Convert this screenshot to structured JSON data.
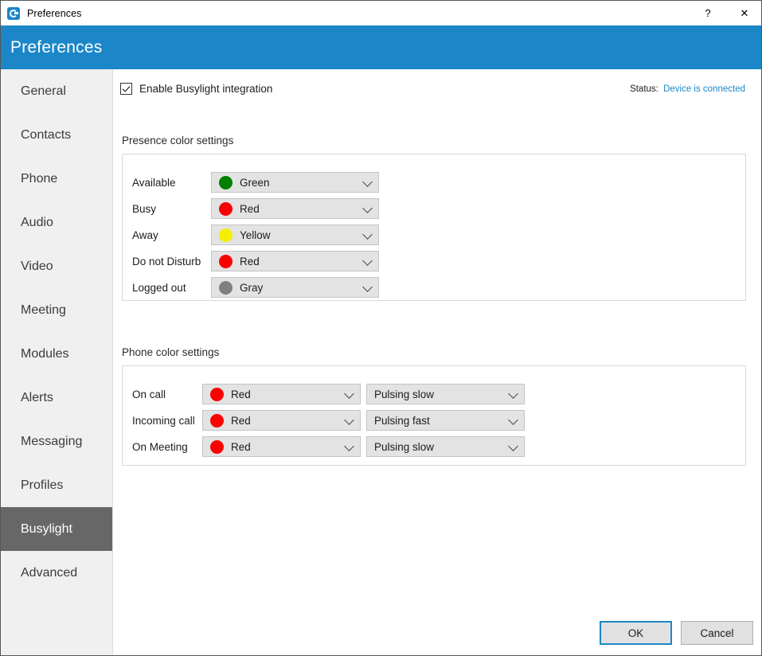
{
  "window": {
    "title": "Preferences",
    "app_icon": "app-logo-icon",
    "help_button": "?",
    "close_button": "✕"
  },
  "header": {
    "title": "Preferences"
  },
  "sidebar": {
    "items": [
      {
        "label": "General",
        "selected": false
      },
      {
        "label": "Contacts",
        "selected": false
      },
      {
        "label": "Phone",
        "selected": false
      },
      {
        "label": "Audio",
        "selected": false
      },
      {
        "label": "Video",
        "selected": false
      },
      {
        "label": "Meeting",
        "selected": false
      },
      {
        "label": "Modules",
        "selected": false
      },
      {
        "label": "Alerts",
        "selected": false
      },
      {
        "label": "Messaging",
        "selected": false
      },
      {
        "label": "Profiles",
        "selected": false
      },
      {
        "label": "Busylight",
        "selected": true
      },
      {
        "label": "Advanced",
        "selected": false
      }
    ]
  },
  "main": {
    "enable_checkbox": {
      "label": "Enable Busylight integration",
      "checked": true
    },
    "status": {
      "label": "Status:",
      "value": "Device is connected",
      "value_color": "#1b87c9"
    },
    "presence_section": {
      "title": "Presence color settings",
      "rows": [
        {
          "label": "Available",
          "color_name": "Green",
          "color_hex": "#008000"
        },
        {
          "label": "Busy",
          "color_name": "Red",
          "color_hex": "#fa0000"
        },
        {
          "label": "Away",
          "color_name": "Yellow",
          "color_hex": "#f5ee00"
        },
        {
          "label": "Do not Disturb",
          "color_name": "Red",
          "color_hex": "#fa0000"
        },
        {
          "label": "Logged out",
          "color_name": "Gray",
          "color_hex": "#808080"
        }
      ]
    },
    "phone_section": {
      "title": "Phone color settings",
      "rows": [
        {
          "label": "On call",
          "color_name": "Red",
          "color_hex": "#fa0000",
          "pattern": "Pulsing slow"
        },
        {
          "label": "Incoming call",
          "color_name": "Red",
          "color_hex": "#fa0000",
          "pattern": "Pulsing fast"
        },
        {
          "label": "On Meeting",
          "color_name": "Red",
          "color_hex": "#fa0000",
          "pattern": "Pulsing slow"
        }
      ]
    }
  },
  "footer": {
    "ok_label": "OK",
    "cancel_label": "Cancel"
  }
}
